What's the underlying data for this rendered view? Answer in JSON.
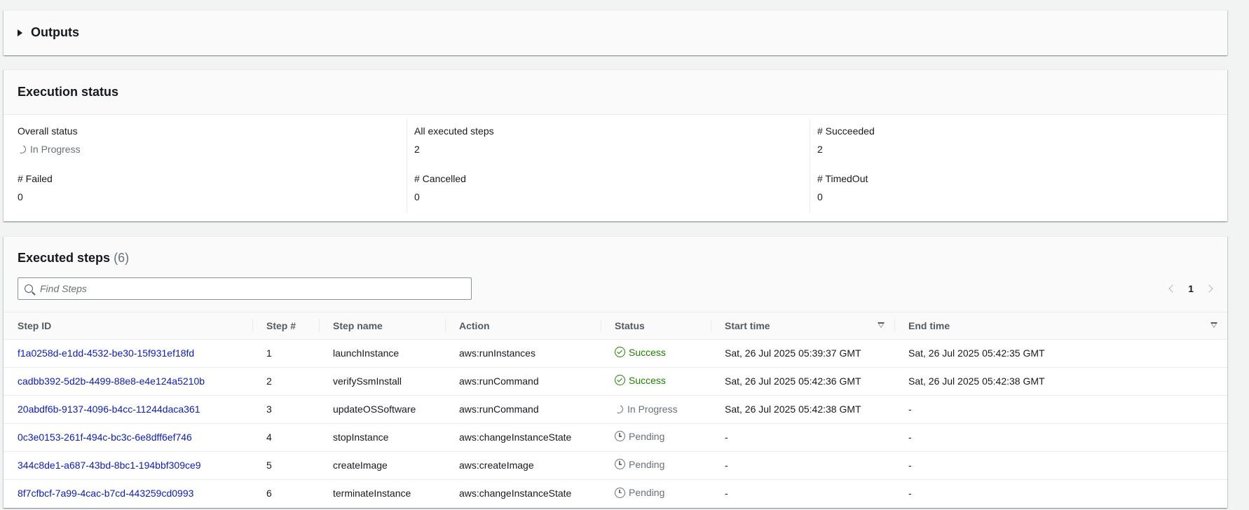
{
  "outputs": {
    "title": "Outputs"
  },
  "execution_status": {
    "title": "Execution status",
    "overall_status_label": "Overall status",
    "overall_status_value": "In Progress",
    "all_steps_label": "All executed steps",
    "all_steps_value": "2",
    "succeeded_label": "# Succeeded",
    "succeeded_value": "2",
    "failed_label": "# Failed",
    "failed_value": "0",
    "cancelled_label": "# Cancelled",
    "cancelled_value": "0",
    "timedout_label": "# TimedOut",
    "timedout_value": "0"
  },
  "executed_steps": {
    "title": "Executed steps",
    "count": "(6)",
    "search_placeholder": "Find Steps",
    "page": "1",
    "columns": [
      "Step ID",
      "Step #",
      "Step name",
      "Action",
      "Status",
      "Start time",
      "End time"
    ],
    "rows": [
      {
        "id": "f1a0258d-e1dd-4532-be30-15f931ef18fd",
        "num": "1",
        "name": "launchInstance",
        "action": "aws:runInstances",
        "status": "Success",
        "start": "Sat, 26 Jul 2025 05:39:37 GMT",
        "end": "Sat, 26 Jul 2025 05:42:35 GMT"
      },
      {
        "id": "cadbb392-5d2b-4499-88e8-e4e124a5210b",
        "num": "2",
        "name": "verifySsmInstall",
        "action": "aws:runCommand",
        "status": "Success",
        "start": "Sat, 26 Jul 2025 05:42:36 GMT",
        "end": "Sat, 26 Jul 2025 05:42:38 GMT"
      },
      {
        "id": "20abdf6b-9137-4096-b4cc-11244daca361",
        "num": "3",
        "name": "updateOSSoftware",
        "action": "aws:runCommand",
        "status": "In Progress",
        "start": "Sat, 26 Jul 2025 05:42:38 GMT",
        "end": "-"
      },
      {
        "id": "0c3e0153-261f-494c-bc3c-6e8dff6ef746",
        "num": "4",
        "name": "stopInstance",
        "action": "aws:changeInstanceState",
        "status": "Pending",
        "start": "-",
        "end": "-"
      },
      {
        "id": "344c8de1-a687-43bd-8bc1-194bbf309ce9",
        "num": "5",
        "name": "createImage",
        "action": "aws:createImage",
        "status": "Pending",
        "start": "-",
        "end": "-"
      },
      {
        "id": "8f7cfbcf-7a99-4cac-b7cd-443259cd0993",
        "num": "6",
        "name": "terminateInstance",
        "action": "aws:changeInstanceState",
        "status": "Pending",
        "start": "-",
        "end": "-"
      }
    ]
  },
  "colors": {
    "link": "#0a1bc2",
    "success": "#1d8102",
    "muted": "#687078"
  }
}
